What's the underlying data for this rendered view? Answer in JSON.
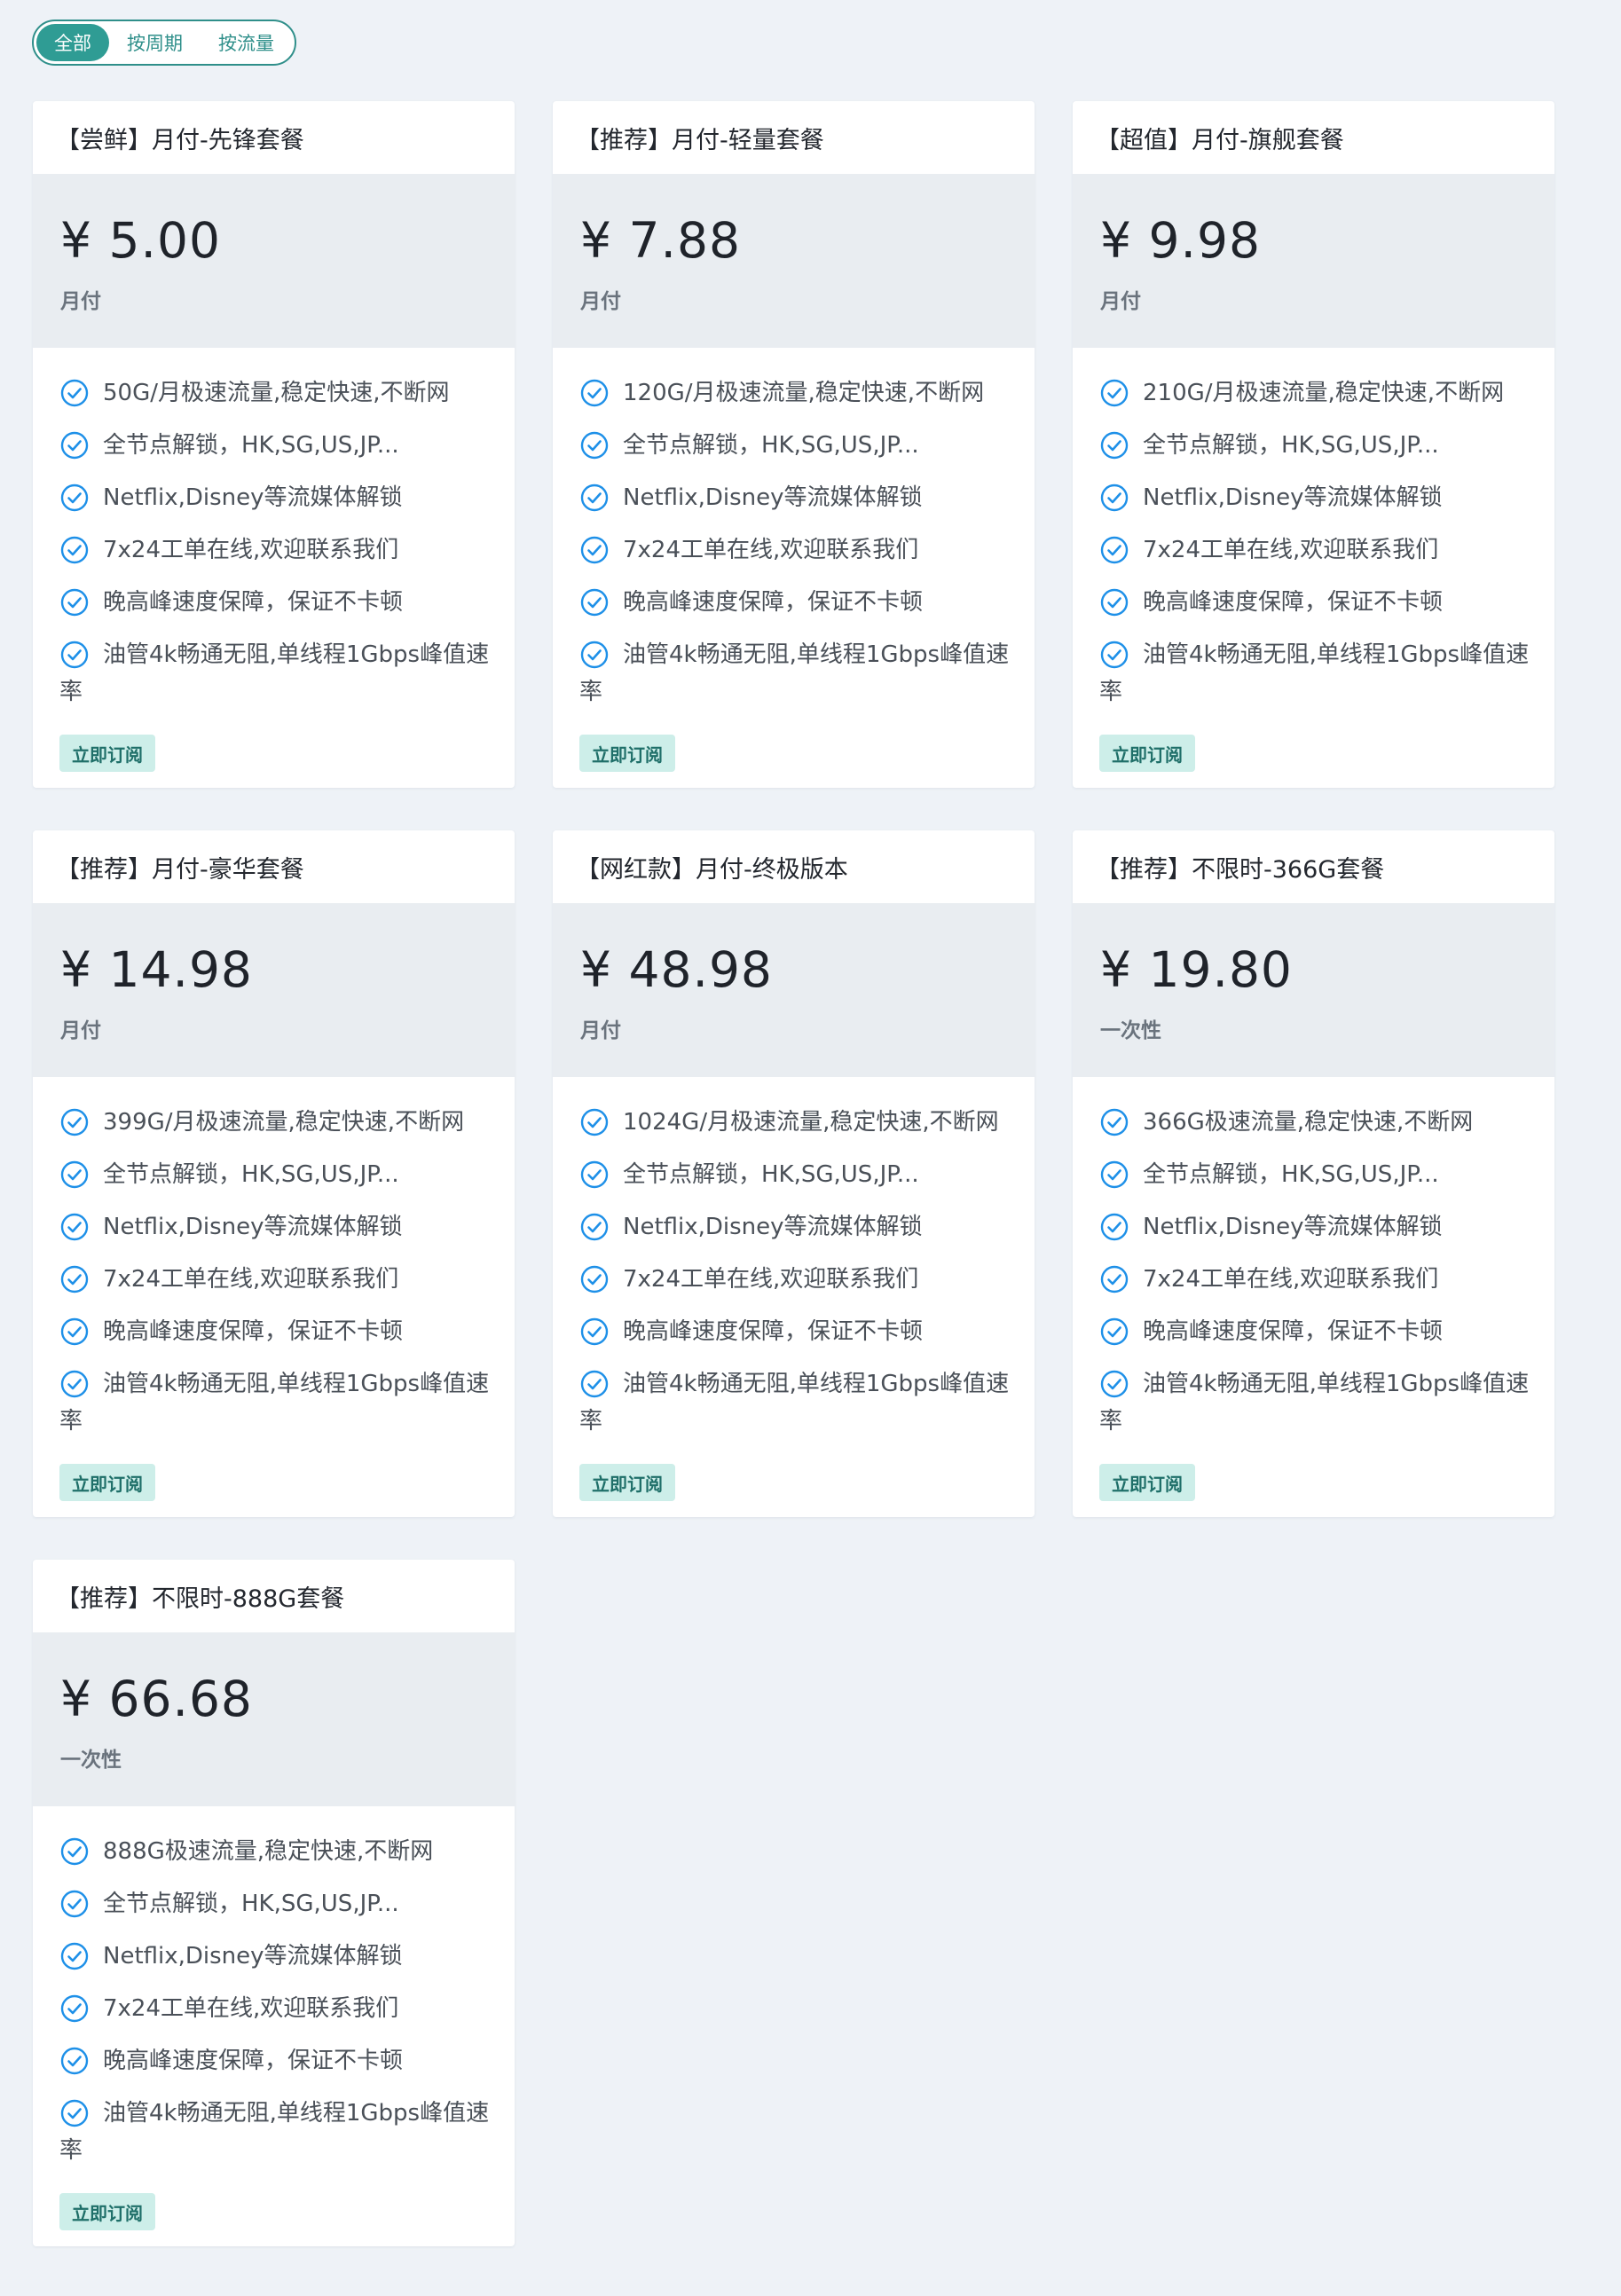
{
  "filter": {
    "options": [
      "全部",
      "按周期",
      "按流量"
    ],
    "active_index": 0
  },
  "colors": {
    "accent": "#2f9c94",
    "check": "#1e90e8",
    "price_bg": "#e9edf1",
    "button_bg": "#cdeee9"
  },
  "subscribe_label": "立即订阅",
  "plans": [
    {
      "title": "【尝鲜】月付-先锋套餐",
      "price": "¥ 5.00",
      "period": "月付",
      "features": [
        "50G/月极速流量,稳定快速,不断网",
        "全节点解锁，HK,SG,US,JP...",
        "Netflix,Disney等流媒体解锁",
        "7x24工单在线,欢迎联系我们",
        "晚高峰速度保障，保证不卡顿",
        "油管4k畅通无阻,单线程1Gbps峰值速率"
      ]
    },
    {
      "title": "【推荐】月付-轻量套餐",
      "price": "¥ 7.88",
      "period": "月付",
      "features": [
        "120G/月极速流量,稳定快速,不断网",
        "全节点解锁，HK,SG,US,JP...",
        "Netflix,Disney等流媒体解锁",
        "7x24工单在线,欢迎联系我们",
        "晚高峰速度保障，保证不卡顿",
        "油管4k畅通无阻,单线程1Gbps峰值速率"
      ]
    },
    {
      "title": "【超值】月付-旗舰套餐",
      "price": "¥ 9.98",
      "period": "月付",
      "features": [
        "210G/月极速流量,稳定快速,不断网",
        "全节点解锁，HK,SG,US,JP...",
        "Netflix,Disney等流媒体解锁",
        "7x24工单在线,欢迎联系我们",
        "晚高峰速度保障，保证不卡顿",
        "油管4k畅通无阻,单线程1Gbps峰值速率"
      ]
    },
    {
      "title": "【推荐】月付-豪华套餐",
      "price": "¥ 14.98",
      "period": "月付",
      "features": [
        "399G/月极速流量,稳定快速,不断网",
        "全节点解锁，HK,SG,US,JP...",
        "Netflix,Disney等流媒体解锁",
        "7x24工单在线,欢迎联系我们",
        "晚高峰速度保障，保证不卡顿",
        "油管4k畅通无阻,单线程1Gbps峰值速率"
      ]
    },
    {
      "title": "【网红款】月付-终极版本",
      "price": "¥ 48.98",
      "period": "月付",
      "features": [
        "1024G/月极速流量,稳定快速,不断网",
        "全节点解锁，HK,SG,US,JP...",
        "Netflix,Disney等流媒体解锁",
        "7x24工单在线,欢迎联系我们",
        "晚高峰速度保障，保证不卡顿",
        "油管4k畅通无阻,单线程1Gbps峰值速率"
      ]
    },
    {
      "title": "【推荐】不限时-366G套餐",
      "price": "¥ 19.80",
      "period": "一次性",
      "features": [
        "366G极速流量,稳定快速,不断网",
        "全节点解锁，HK,SG,US,JP...",
        "Netflix,Disney等流媒体解锁",
        "7x24工单在线,欢迎联系我们",
        "晚高峰速度保障，保证不卡顿",
        "油管4k畅通无阻,单线程1Gbps峰值速率"
      ]
    },
    {
      "title": "【推荐】不限时-888G套餐",
      "price": "¥ 66.68",
      "period": "一次性",
      "features": [
        "888G极速流量,稳定快速,不断网",
        "全节点解锁，HK,SG,US,JP...",
        "Netflix,Disney等流媒体解锁",
        "7x24工单在线,欢迎联系我们",
        "晚高峰速度保障，保证不卡顿",
        "油管4k畅通无阻,单线程1Gbps峰值速率"
      ]
    }
  ]
}
